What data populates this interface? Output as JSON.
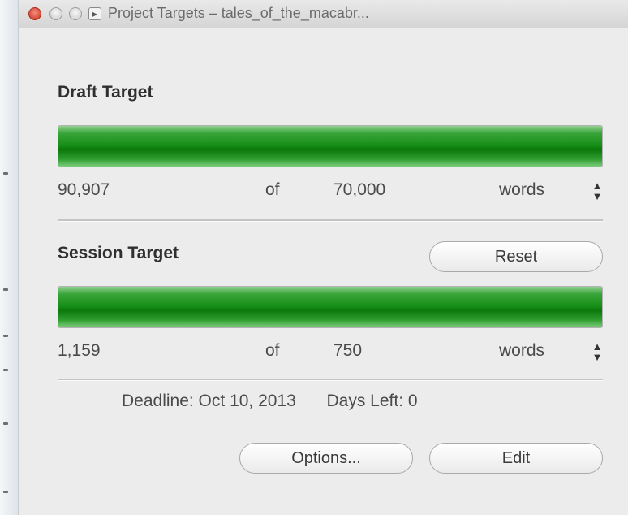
{
  "window": {
    "title": "Project Targets – tales_of_the_macabr..."
  },
  "draft": {
    "heading": "Draft Target",
    "current": "90,907",
    "of": "of",
    "target": "70,000",
    "unit": "words",
    "progress_percent": 100
  },
  "session": {
    "heading": "Session Target",
    "reset_label": "Reset",
    "current": "1,159",
    "of": "of",
    "target": "750",
    "unit": "words",
    "progress_percent": 100
  },
  "deadline": {
    "label": "Deadline: Oct 10, 2013",
    "days_left": "Days Left: 0"
  },
  "buttons": {
    "options_label": "Options...",
    "edit_label": "Edit"
  },
  "icons": {
    "stepper": "up-down-arrows-icon",
    "document": "document-proxy-icon"
  },
  "colors": {
    "progress_green": "#168e16",
    "close_red": "#c9321f"
  }
}
